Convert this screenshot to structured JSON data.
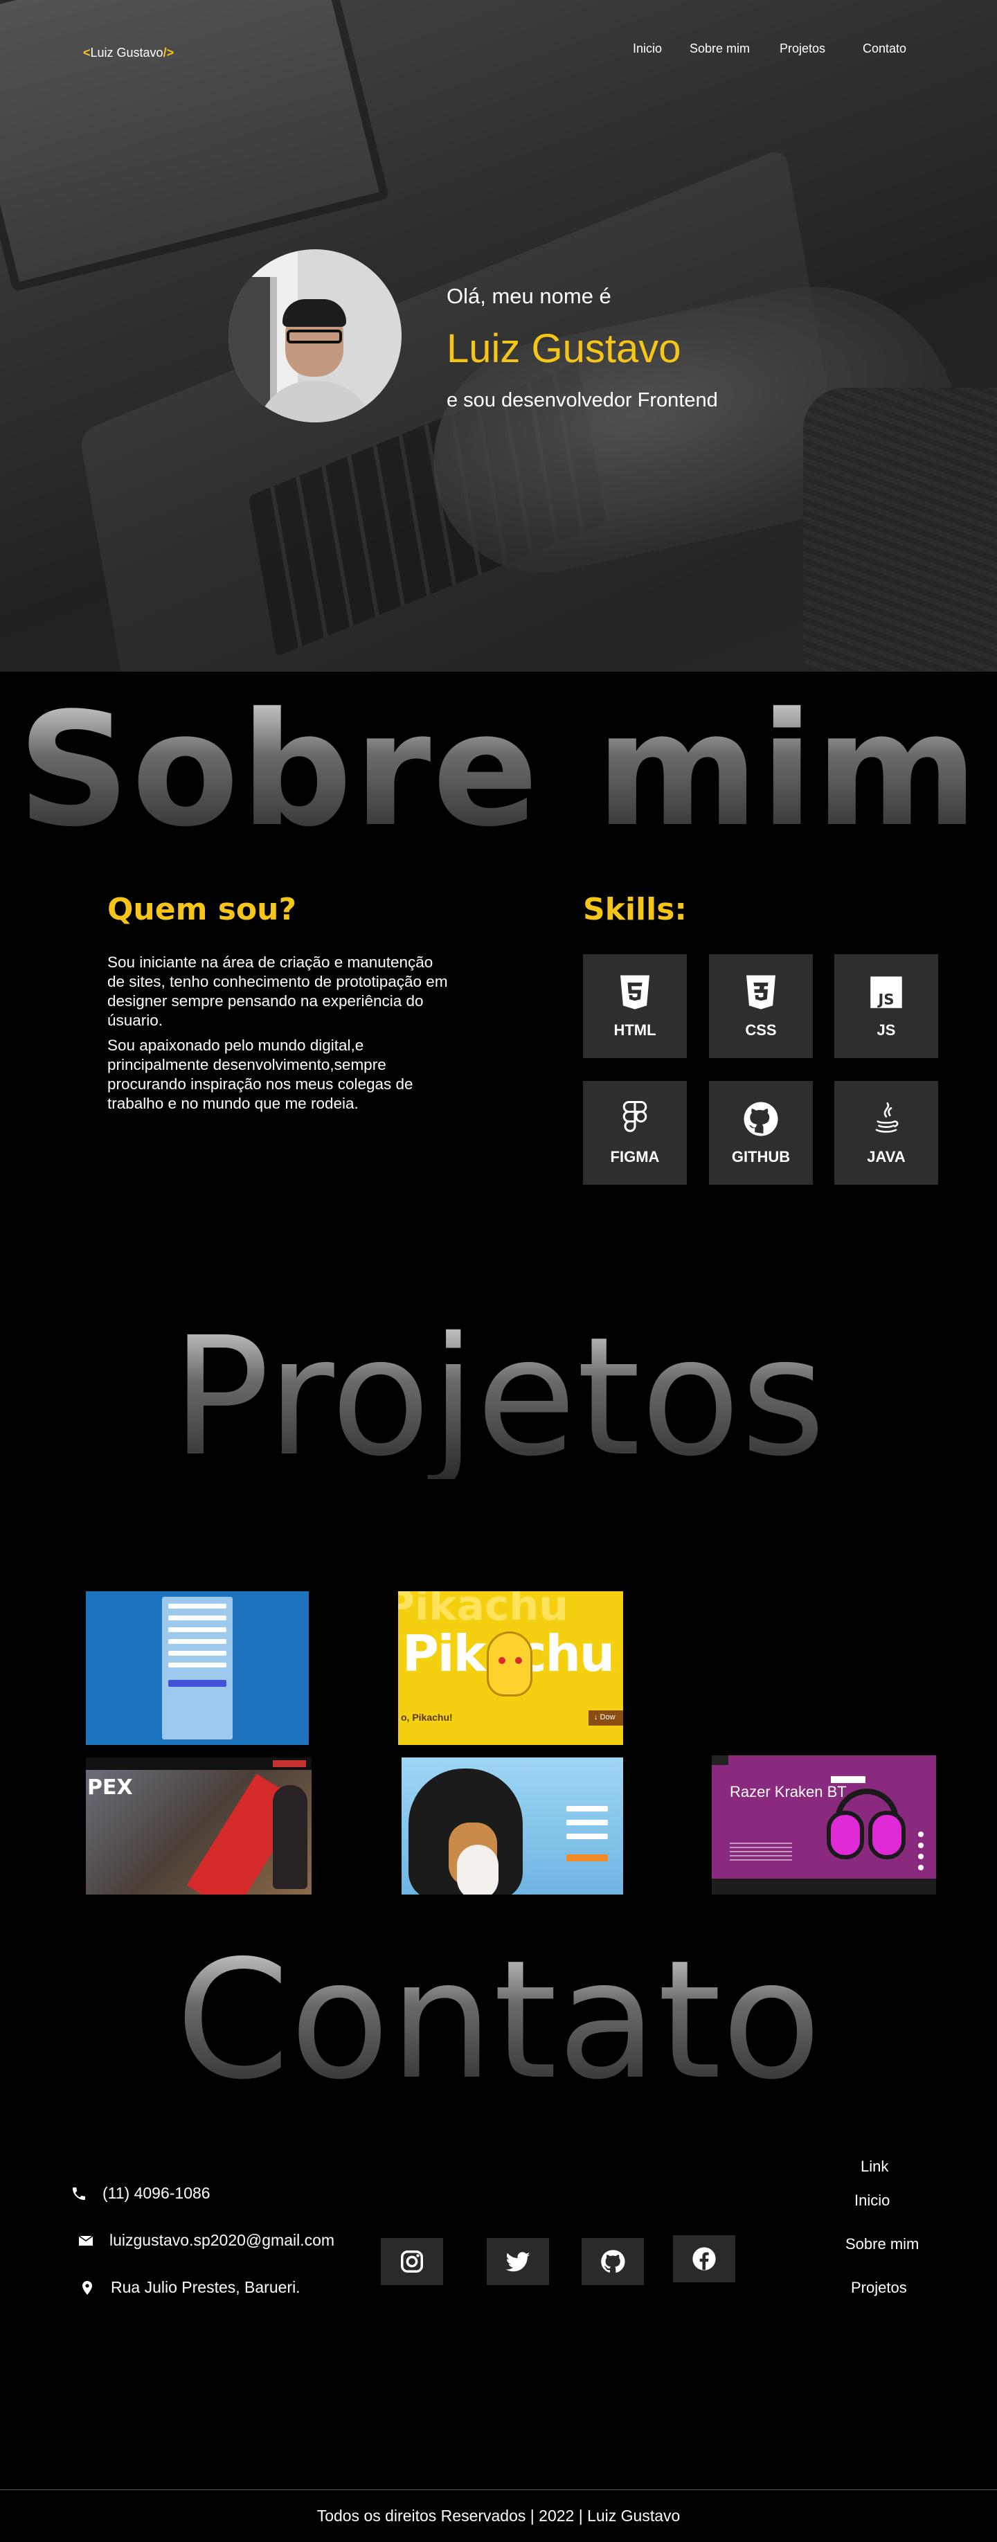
{
  "header": {
    "logo_open": "<",
    "logo_text": "Luiz Gustavo",
    "logo_close": "/>",
    "nav": [
      "Inicio",
      "Sobre mim",
      "Projetos",
      "Contato"
    ]
  },
  "hero": {
    "greeting": "Olá, meu nome é",
    "name": "Luiz Gustavo",
    "role": "e sou desenvolvedor Frontend"
  },
  "about": {
    "section_title": "Sobre mim",
    "who_title": "Quem sou?",
    "paragraphs": [
      "Sou iniciante na área de criação e manutenção de sites, tenho conhecimento de prototipação em designer sempre pensando na experiência do úsuario.",
      "Sou apaixonado pelo mundo digital,e principalmente desenvolvimento,sempre procurando inspiração nos meus colegas de trabalho e no mundo que me rodeia."
    ],
    "skills_title": "Skills:",
    "skills": [
      {
        "label": "HTML",
        "icon": "html5-icon"
      },
      {
        "label": "CSS",
        "icon": "css3-icon"
      },
      {
        "label": "JS",
        "icon": "js-icon"
      },
      {
        "label": "FIGMA",
        "icon": "figma-icon"
      },
      {
        "label": "GITHUB",
        "icon": "github-icon"
      },
      {
        "label": "JAVA",
        "icon": "java-icon"
      }
    ]
  },
  "projects": {
    "section_title": "Projetos",
    "pikachu_bg_word": "Pikachu",
    "pikachu_word": "Pikachu",
    "pikachu_caption": "o, Pikachu!",
    "pikachu_button": "↓ Dow",
    "apex_title": "PEX",
    "razer_title": "Razer Kraken BT"
  },
  "contact": {
    "section_title": "Contato",
    "phone": "(11) 4096-1086",
    "email": "luizgustavo.sp2020@gmail.com",
    "address": "Rua Julio Prestes, Barueri.",
    "social": [
      "instagram-icon",
      "twitter-icon",
      "github-icon",
      "facebook-icon"
    ],
    "links_title": "Link",
    "links": [
      "Inicio",
      "Sobre mim",
      "Projetos"
    ]
  },
  "footer": {
    "text": "Todos os direitos Reservados | 2022 | Luiz Gustavo"
  },
  "colors": {
    "accent": "#f5c518",
    "background": "#000000",
    "card": "#2e2e2e"
  }
}
